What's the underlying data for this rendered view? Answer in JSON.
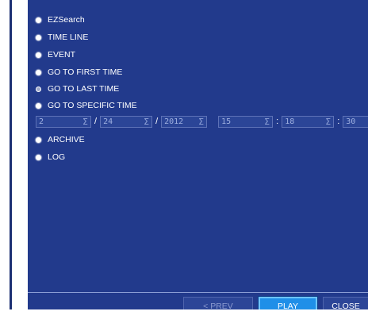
{
  "menu": {
    "items": [
      {
        "label": "EZSearch",
        "selected": true
      },
      {
        "label": "TIME LINE",
        "selected": true
      },
      {
        "label": "EVENT",
        "selected": true
      },
      {
        "label": "GO TO FIRST TIME",
        "selected": true
      },
      {
        "label": "GO TO LAST TIME",
        "selected": false
      },
      {
        "label": "GO TO SPECIFIC TIME",
        "selected": true
      },
      {
        "label": "ARCHIVE",
        "selected": true
      },
      {
        "label": "LOG",
        "selected": true
      }
    ]
  },
  "specific_time": {
    "month": "2",
    "day": "24",
    "year": "2012",
    "hour": "15",
    "minute": "18",
    "second": "30",
    "date_sep": "/",
    "time_sep": ":",
    "spin_glyph": "Σ"
  },
  "buttons": {
    "prev": "< PREV",
    "play": "PLAY",
    "close": "CLOSE"
  },
  "colors": {
    "panel_bg": "#223a8c",
    "play_bg": "#1f8fe8"
  }
}
